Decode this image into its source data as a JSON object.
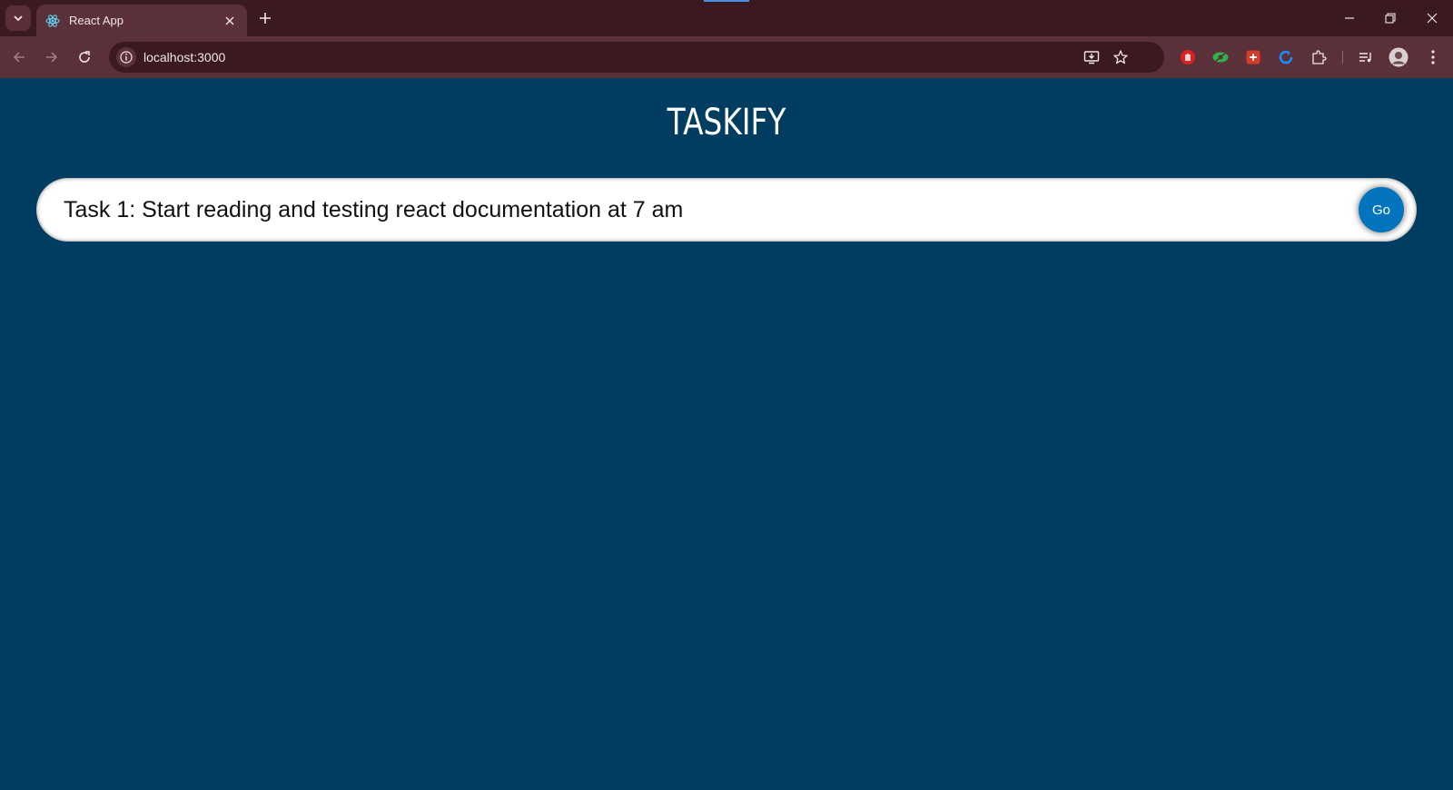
{
  "browser": {
    "tab_title": "React App",
    "url": "localhost:3000",
    "favicon_icon": "react-logo-icon"
  },
  "app": {
    "title": "TASKIFY",
    "task_input_value": "Task 1: Start reading and testing react documentation at 7 am",
    "go_label": "Go"
  },
  "colors": {
    "page_background": "#003d61",
    "chrome_dark": "#3a1a20",
    "chrome_mid": "#5b3139",
    "go_button": "#0374bd"
  }
}
